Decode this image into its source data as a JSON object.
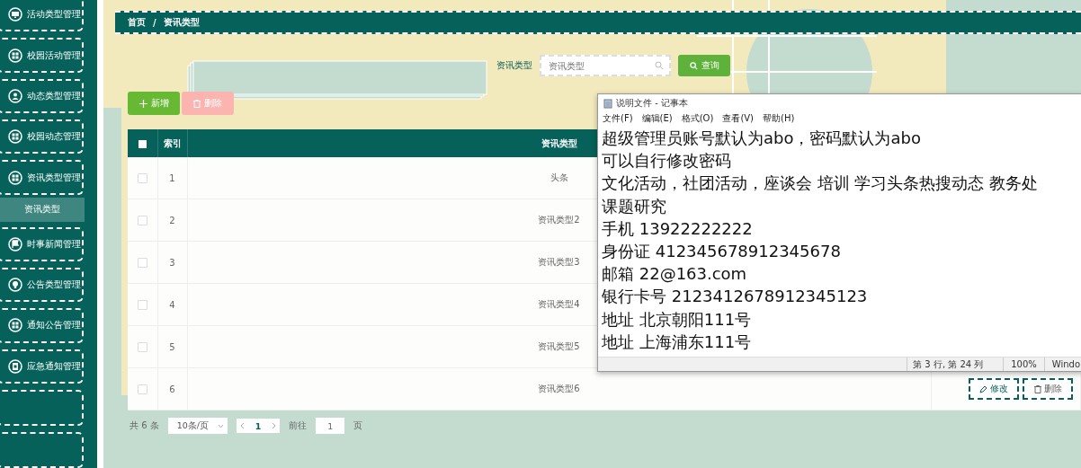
{
  "sidebar": {
    "items": [
      {
        "label": "活动类型管理",
        "expanded": false
      },
      {
        "label": "校园活动管理",
        "expanded": false
      },
      {
        "label": "动态类型管理",
        "expanded": false
      },
      {
        "label": "校园动态管理",
        "expanded": false
      },
      {
        "label": "资讯类型管理",
        "expanded": true,
        "children": [
          {
            "label": "资讯类型",
            "selected": true
          }
        ]
      },
      {
        "label": "时事新闻管理",
        "expanded": false
      },
      {
        "label": "公告类型管理",
        "expanded": false
      },
      {
        "label": "通知公告管理",
        "expanded": false
      },
      {
        "label": "应急通知管理",
        "expanded": false
      }
    ]
  },
  "breadcrumb": [
    "首页",
    "/",
    "资讯类型"
  ],
  "search": {
    "label": "资讯类型",
    "placeholder": "资讯类型",
    "button": "查询"
  },
  "actions": [
    {
      "label": "新增",
      "kind": "add"
    },
    {
      "label": "删除",
      "kind": "delete"
    }
  ],
  "table": {
    "all_selected": false,
    "columns": [
      "索引",
      "资讯类型"
    ],
    "rows": [
      {
        "index": "1",
        "name": "头条",
        "selected": false
      },
      {
        "index": "2",
        "name": "资讯类型2",
        "selected": false
      },
      {
        "index": "3",
        "name": "资讯类型3",
        "selected": false
      },
      {
        "index": "4",
        "name": "资讯类型4",
        "selected": false
      },
      {
        "index": "5",
        "name": "资讯类型5",
        "selected": false
      },
      {
        "index": "6",
        "name": "资讯类型6",
        "selected": false,
        "actions": [
          {
            "label": "修改",
            "kind": "edit"
          },
          {
            "label": "删除",
            "kind": "delete"
          }
        ]
      }
    ]
  },
  "pagination": {
    "total": "共 6 条",
    "page_size": "10条/页",
    "pages": [
      {
        "label": "1",
        "selected": true
      }
    ],
    "goto_label": "前往",
    "goto_value": "1",
    "goto_suffix": "页"
  },
  "notepad": {
    "title": "说明文件 - 记事本",
    "menu": [
      "文件(F)",
      "编辑(E)",
      "格式(O)",
      "查看(V)",
      "帮助(H)"
    ],
    "lines": [
      "超级管理员账号默认为abo，密码默认为abo",
      "可以自行修改密码",
      "文化活动，社团活动，座谈会 培训 学习头条热搜动态 教务处",
      "课题研究",
      "手机 13922222222",
      "身份证 412345678912345678",
      "邮箱 22@163.com",
      "银行卡号 2123412678912345123",
      "地址 北京朝阳111号",
      "地址 上海浦东111号"
    ],
    "status": [
      "第 3 行, 第 24 列",
      "100%",
      "Windo"
    ]
  }
}
